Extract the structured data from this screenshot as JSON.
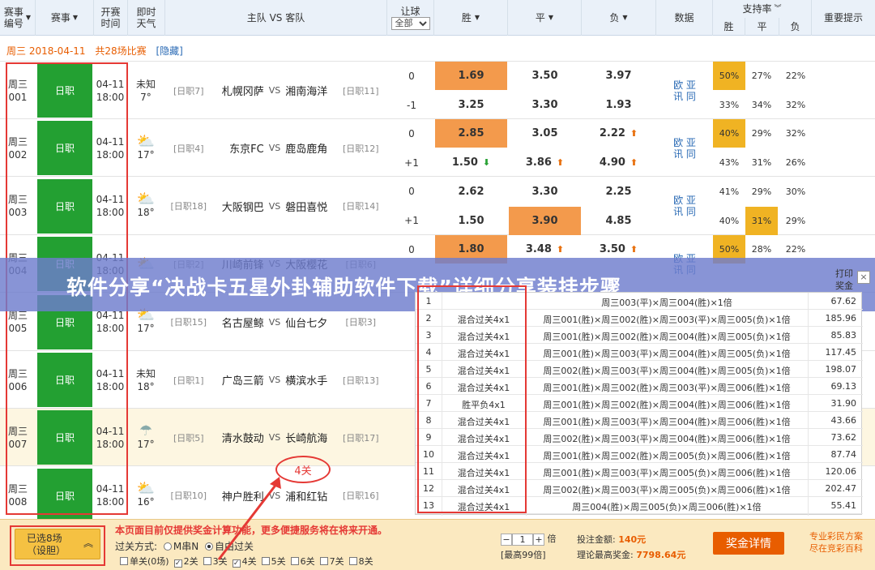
{
  "header": {
    "match_no": "赛事\n编号",
    "league": "赛事",
    "time": "开赛\n时间",
    "weather": "即时\n天气",
    "teams": "主队 VS 客队",
    "handicap": "让球",
    "handicap_select": "全部",
    "win": "胜",
    "draw": "平",
    "lose": "负",
    "data": "数据",
    "support": "支持率",
    "support_win": "胜",
    "support_draw": "平",
    "support_lose": "负",
    "hint": "重要提示"
  },
  "dateline": {
    "date": "周三 2018-04-11",
    "count": "共28场比赛",
    "hide": "[隐藏]"
  },
  "matches": [
    {
      "no": "周三\n001",
      "league": "日职",
      "time": "04-11\n18:00",
      "weather": "未知",
      "temp": "7°",
      "icon": "none",
      "hrank": "[日职7]",
      "home": "札幌冈萨",
      "away": "湘南海洋",
      "arank": "[日职11]",
      "h1": "0",
      "h2": "-1",
      "o1": [
        "1.69",
        "3.50",
        "3.97"
      ],
      "o2": [
        "3.25",
        "3.30",
        "1.93"
      ],
      "a1": [
        "",
        "",
        ""
      ],
      "a2": [
        "",
        "",
        ""
      ],
      "p1": [
        "50%",
        "27%",
        "22%"
      ],
      "p2": [
        "33%",
        "34%",
        "32%"
      ],
      "hi1": [
        0
      ],
      "hi2": [],
      "ph1": [
        0
      ],
      "ph2": []
    },
    {
      "no": "周三\n002",
      "league": "日职",
      "time": "04-11\n18:00",
      "weather": "",
      "temp": "17°",
      "icon": "partly-cloudy-icon",
      "hrank": "[日职4]",
      "home": "东京FC",
      "away": "鹿岛鹿角",
      "arank": "[日职12]",
      "h1": "0",
      "h2": "+1",
      "o1": [
        "2.85",
        "3.05",
        "2.22"
      ],
      "o2": [
        "1.50",
        "3.86",
        "4.90"
      ],
      "a1": [
        "",
        "",
        "up"
      ],
      "a2": [
        "dn",
        "up",
        "up"
      ],
      "p1": [
        "40%",
        "29%",
        "32%"
      ],
      "p2": [
        "43%",
        "31%",
        "26%"
      ],
      "hi1": [
        0
      ],
      "hi2": [],
      "ph1": [
        0
      ],
      "ph2": []
    },
    {
      "no": "周三\n003",
      "league": "日职",
      "time": "04-11\n18:00",
      "weather": "",
      "temp": "18°",
      "icon": "partly-cloudy-icon",
      "hrank": "[日职18]",
      "home": "大阪钢巴",
      "away": "磐田喜悦",
      "arank": "[日职14]",
      "h1": "0",
      "h2": "+1",
      "o1": [
        "2.62",
        "3.30",
        "2.25"
      ],
      "o2": [
        "1.50",
        "3.90",
        "4.85"
      ],
      "a1": [
        "",
        "",
        ""
      ],
      "a2": [
        "",
        "",
        ""
      ],
      "p1": [
        "41%",
        "29%",
        "30%"
      ],
      "p2": [
        "40%",
        "31%",
        "29%"
      ],
      "hi1": [],
      "hi2": [
        1
      ],
      "ph1": [],
      "ph2": [
        1
      ]
    },
    {
      "no": "周三\n004",
      "league": "日职",
      "time": "04-11\n18:00",
      "weather": "",
      "temp": "",
      "icon": "partly-cloudy-icon",
      "hrank": "[日职2]",
      "home": "川崎前锋",
      "away": "大阪樱花",
      "arank": "[日职6]",
      "h1": "0",
      "h2": "",
      "o1": [
        "1.80",
        "3.48",
        "3.50"
      ],
      "o2": [
        "",
        "",
        ""
      ],
      "a1": [
        "",
        "up",
        "up"
      ],
      "a2": [
        "",
        "",
        ""
      ],
      "p1": [
        "50%",
        "28%",
        "22%"
      ],
      "p2": [
        "",
        "",
        ""
      ],
      "hi1": [
        0
      ],
      "hi2": [],
      "ph1": [
        0
      ],
      "ph2": []
    },
    {
      "no": "周三\n005",
      "league": "日职",
      "time": "04-11\n18:00",
      "weather": "",
      "temp": "17°",
      "icon": "partly-cloudy-icon",
      "hrank": "[日职15]",
      "home": "名古屋鲸",
      "away": "仙台七夕",
      "arank": "[日职3]",
      "h1": "",
      "h2": "",
      "o1": [
        "",
        "",
        ""
      ],
      "o2": [
        "",
        "",
        ""
      ],
      "a1": [
        "",
        "",
        ""
      ],
      "a2": [
        "",
        "",
        ""
      ],
      "p1": [
        "",
        "",
        ""
      ],
      "p2": [
        "",
        "",
        ""
      ],
      "hi1": [],
      "hi2": [],
      "ph1": [],
      "ph2": []
    },
    {
      "no": "周三\n006",
      "league": "日职",
      "time": "04-11\n18:00",
      "weather": "未知",
      "temp": "18°",
      "icon": "none",
      "hrank": "[日职1]",
      "home": "广岛三箭",
      "away": "横滨水手",
      "arank": "[日职13]",
      "h1": "",
      "h2": "",
      "o1": [
        "",
        "",
        ""
      ],
      "o2": [
        "",
        "",
        ""
      ],
      "a1": [
        "",
        "",
        ""
      ],
      "a2": [
        "",
        "",
        ""
      ],
      "p1": [
        "",
        "",
        ""
      ],
      "p2": [
        "",
        "",
        ""
      ],
      "hi1": [],
      "hi2": [],
      "ph1": [],
      "ph2": []
    },
    {
      "no": "周三\n007",
      "league": "日职",
      "time": "04-11\n18:00",
      "weather": "",
      "temp": "17°",
      "icon": "rain-icon",
      "hrank": "[日职5]",
      "home": "清水鼓动",
      "away": "长崎航海",
      "arank": "[日职17]",
      "h1": "",
      "h2": "",
      "o1": [
        "",
        "",
        ""
      ],
      "o2": [
        "",
        "",
        ""
      ],
      "a1": [
        "",
        "",
        ""
      ],
      "a2": [
        "",
        "",
        ""
      ],
      "p1": [
        "",
        "",
        ""
      ],
      "p2": [
        "",
        "",
        ""
      ],
      "hi1": [],
      "hi2": [],
      "ph1": [],
      "ph2": []
    },
    {
      "no": "周三\n008",
      "league": "日职",
      "time": "04-11\n18:00",
      "weather": "",
      "temp": "16°",
      "icon": "partly-cloudy-icon",
      "hrank": "[日职10]",
      "home": "神户胜利",
      "away": "浦和红钻",
      "arank": "[日职16]",
      "h1": "",
      "h2": "",
      "o1": [
        "",
        "",
        ""
      ],
      "o2": [
        "",
        "",
        ""
      ],
      "a1": [
        "",
        "",
        ""
      ],
      "a2": [
        "",
        "",
        ""
      ],
      "p1": [
        "",
        "",
        ""
      ],
      "p2": [
        "",
        "",
        ""
      ],
      "hi1": [],
      "hi2": [],
      "ph1": [],
      "ph2": []
    }
  ],
  "info_label": "欧 亚\n讯 同",
  "overlay_title": "软件分享“决战卡五星外卦辅助软件下载”详细分享装挂步骤",
  "print_label": "打印\n奖金",
  "close_label": "×",
  "popup_rows": [
    {
      "no": "1",
      "type": "",
      "desc": "周三003(平)×周三004(胜)×1倍",
      "amt": "67.62"
    },
    {
      "no": "2",
      "type": "混合过关4x1",
      "desc": "周三001(胜)×周三002(胜)×周三003(平)×周三005(负)×1倍",
      "amt": "185.96"
    },
    {
      "no": "3",
      "type": "混合过关4x1",
      "desc": "周三001(胜)×周三002(胜)×周三004(胜)×周三005(负)×1倍",
      "amt": "85.83"
    },
    {
      "no": "4",
      "type": "混合过关4x1",
      "desc": "周三001(胜)×周三003(平)×周三004(胜)×周三005(负)×1倍",
      "amt": "117.45"
    },
    {
      "no": "5",
      "type": "混合过关4x1",
      "desc": "周三002(胜)×周三003(平)×周三004(胜)×周三005(负)×1倍",
      "amt": "198.07"
    },
    {
      "no": "6",
      "type": "混合过关4x1",
      "desc": "周三001(胜)×周三002(胜)×周三003(平)×周三006(胜)×1倍",
      "amt": "69.13"
    },
    {
      "no": "7",
      "type": "胜平负4x1",
      "desc": "周三001(胜)×周三002(胜)×周三004(胜)×周三006(胜)×1倍",
      "amt": "31.90"
    },
    {
      "no": "8",
      "type": "混合过关4x1",
      "desc": "周三001(胜)×周三003(平)×周三004(胜)×周三006(胜)×1倍",
      "amt": "43.66"
    },
    {
      "no": "9",
      "type": "混合过关4x1",
      "desc": "周三002(胜)×周三003(平)×周三004(胜)×周三006(胜)×1倍",
      "amt": "73.62"
    },
    {
      "no": "10",
      "type": "混合过关4x1",
      "desc": "周三001(胜)×周三002(胜)×周三005(负)×周三006(胜)×1倍",
      "amt": "87.74"
    },
    {
      "no": "11",
      "type": "混合过关4x1",
      "desc": "周三001(胜)×周三003(平)×周三005(负)×周三006(胜)×1倍",
      "amt": "120.06"
    },
    {
      "no": "12",
      "type": "混合过关4x1",
      "desc": "周三002(胜)×周三003(平)×周三005(负)×周三006(胜)×1倍",
      "amt": "202.47"
    },
    {
      "no": "13",
      "type": "混合过关4x1",
      "desc": "周三004(胜)×周三005(负)×周三006(胜)×1倍",
      "amt": "55.41"
    }
  ],
  "annotation": "4关",
  "bottom": {
    "selected": "已选8场\n（设胆）",
    "notice": "本页面目前仅提供奖金计算功能，更多便捷服务将在将来开通。",
    "mode_label": "过关方式:",
    "mode_mxn": "M串N",
    "mode_free": "自由过关",
    "passes": [
      "单关(0场)",
      "2关",
      "3关",
      "4关",
      "5关",
      "6关",
      "7关",
      "8关"
    ],
    "pass_checked": [
      false,
      true,
      false,
      true,
      false,
      false,
      false,
      false
    ],
    "multiplier": "1",
    "multiplier_unit": "倍",
    "max_mult": "[最高99倍]",
    "total_label": "投注金额:",
    "total_value": "140元",
    "max_label": "理论最高奖金:",
    "max_value": "7798.64元",
    "bonus_btn": "奖金详情",
    "logo_text": "专业彩民方案\n尽在竞彩百科"
  },
  "colors": {
    "header_bg": "#eaf1f9",
    "league_green": "#23a032",
    "odds_orange": "#f39a4c",
    "support_yellow": "#f0b323",
    "overlay": "#6e7dcd",
    "accent": "#e85d00",
    "annotation_red": "#e53935",
    "bar_bg": "#fbe9c0"
  }
}
